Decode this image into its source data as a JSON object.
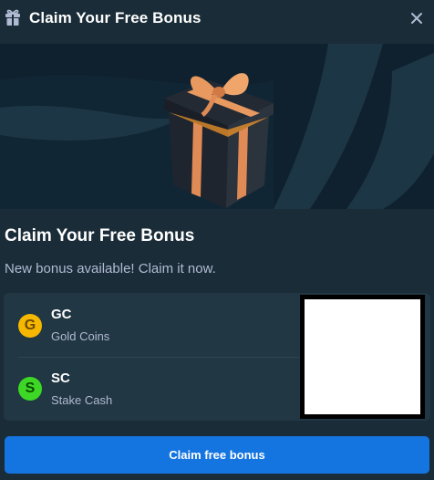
{
  "header": {
    "title": "Claim Your Free Bonus",
    "icon": "gift-icon",
    "close_icon": "close-icon"
  },
  "banner": {
    "image": "gift-box-illustration"
  },
  "content": {
    "heading": "Claim Your Free Bonus",
    "subtext": "New bonus available! Claim it now."
  },
  "currencies": [
    {
      "code": "GC",
      "name": "Gold Coins",
      "symbol": "G",
      "color": "#f5b700"
    },
    {
      "code": "SC",
      "name": "Stake Cash",
      "symbol": "S",
      "color": "#3dd826"
    }
  ],
  "cta": {
    "label": "Claim free bonus"
  },
  "colors": {
    "background": "#1a2c38",
    "banner": "#0f212e",
    "card": "#213743",
    "accent": "#1475e1",
    "muted_text": "#b1bad3"
  }
}
